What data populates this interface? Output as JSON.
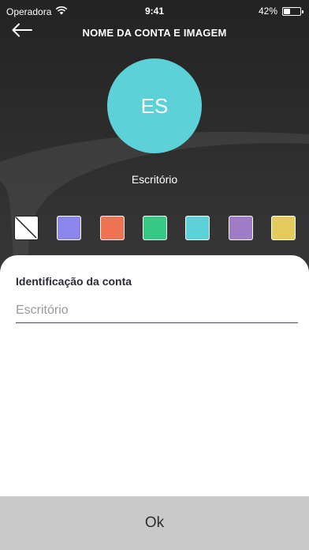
{
  "status_bar": {
    "carrier": "Operadora",
    "time": "9:41",
    "battery_percent": "42%",
    "battery_level": 0.42,
    "wifi_icon": "wifi-icon"
  },
  "header": {
    "title": "NOME DA CONTA E IMAGEM",
    "back_icon": "arrow-left-icon"
  },
  "avatar": {
    "initials": "ES",
    "color": "#5cd1d8"
  },
  "account": {
    "name": "Escritório"
  },
  "colors": [
    {
      "id": "none",
      "hex": "#ffffff"
    },
    {
      "id": "periwinkle",
      "hex": "#8b86ec"
    },
    {
      "id": "coral",
      "hex": "#ee7352"
    },
    {
      "id": "green",
      "hex": "#36c983"
    },
    {
      "id": "cyan",
      "hex": "#5cd1d8"
    },
    {
      "id": "purple",
      "hex": "#a07cc6"
    },
    {
      "id": "yellow",
      "hex": "#e3cb5c"
    }
  ],
  "form": {
    "label": "Identificação da conta",
    "placeholder": "Escritório",
    "value": ""
  },
  "footer": {
    "ok_label": "Ok"
  }
}
